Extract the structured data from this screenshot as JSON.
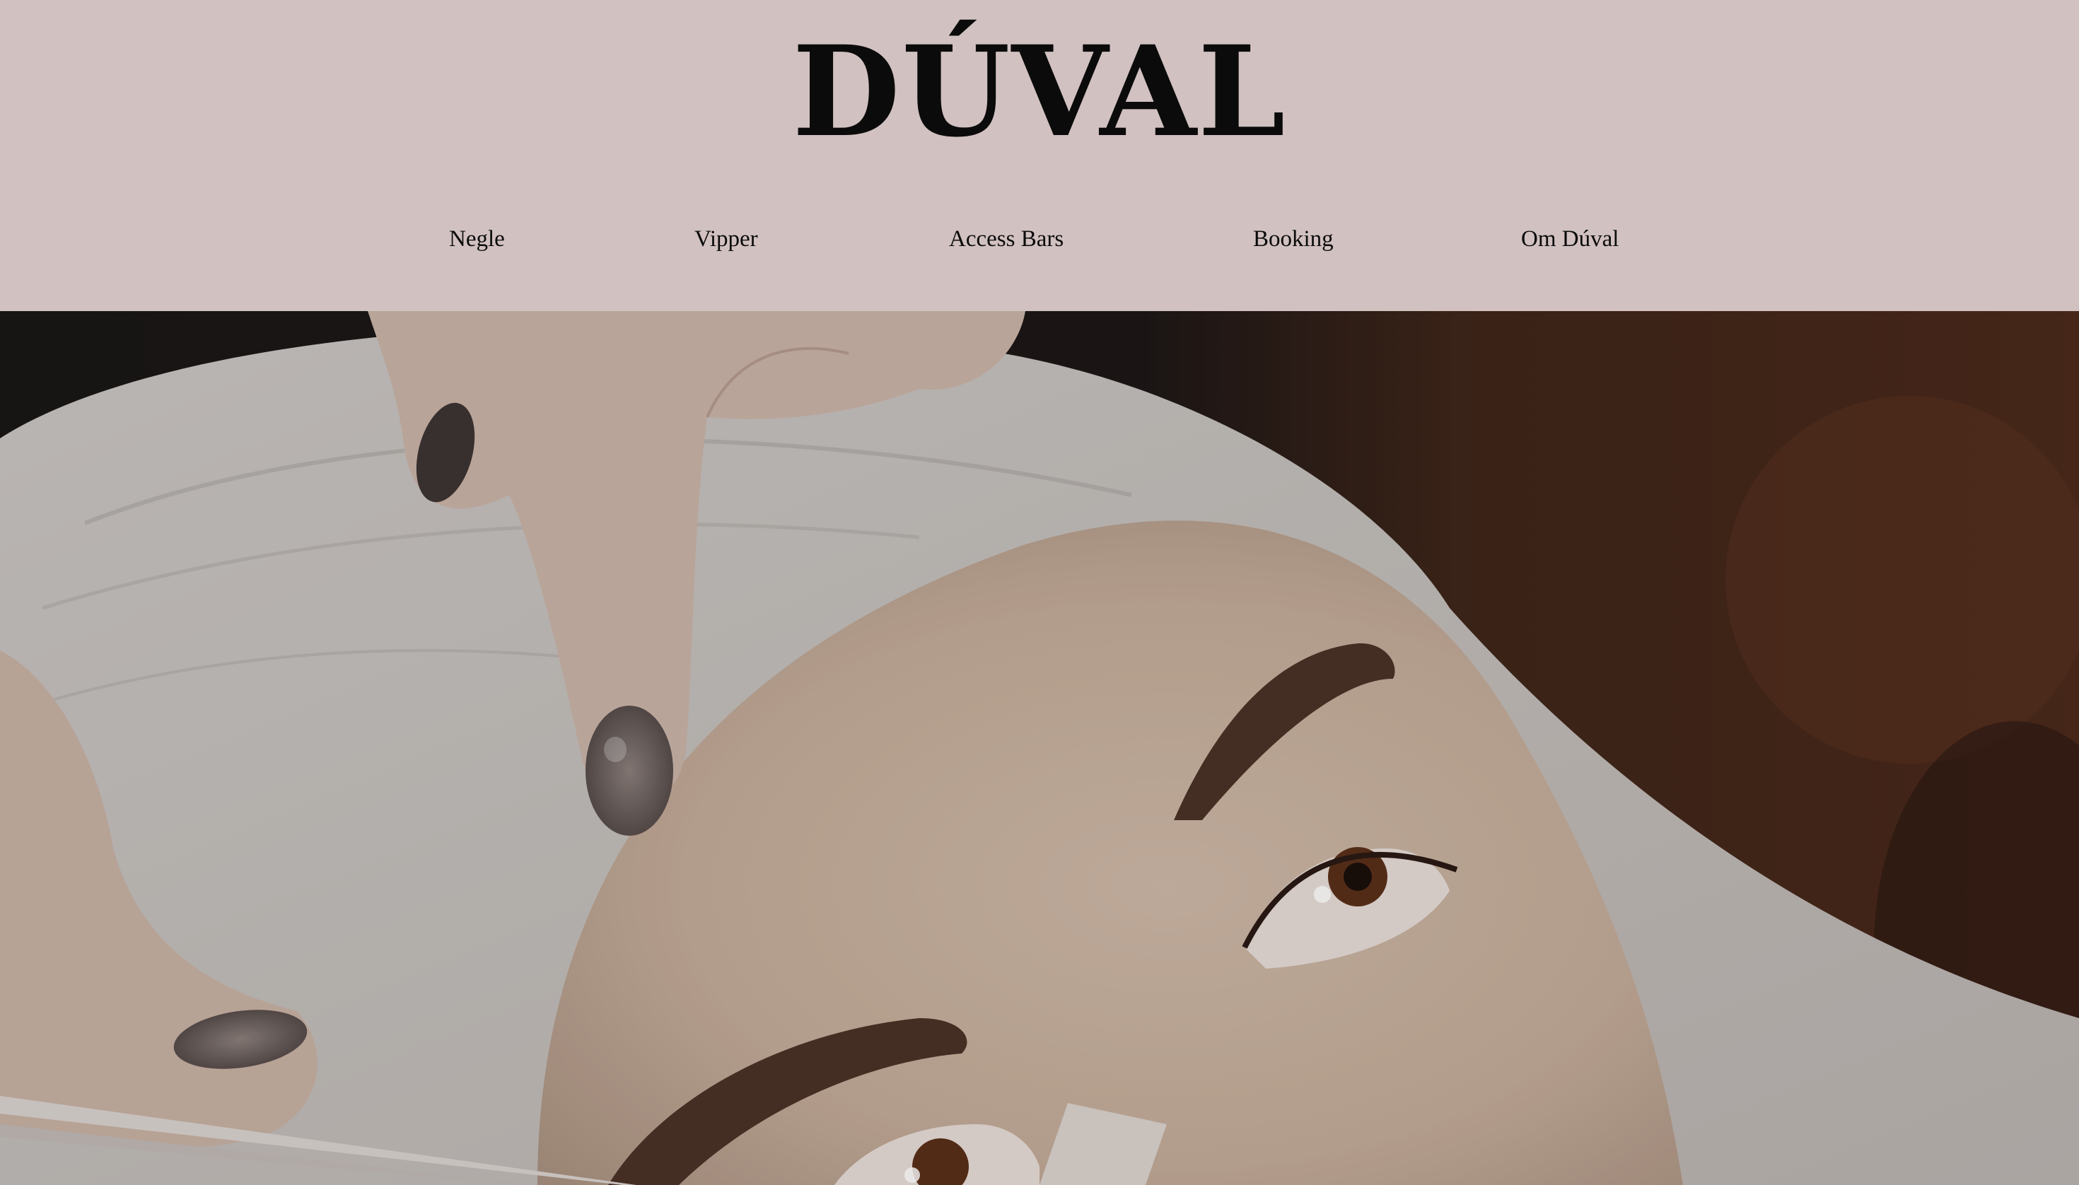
{
  "header": {
    "logo": "DÚVAL"
  },
  "nav": {
    "items": [
      {
        "label": "Negle"
      },
      {
        "label": "Vipper"
      },
      {
        "label": "Access Bars"
      },
      {
        "label": "Booking"
      },
      {
        "label": "Om Dúval"
      }
    ]
  },
  "colors": {
    "header_bg": "#d1c1c0",
    "text": "#0b0b0b",
    "hero_dark": "#1a1615",
    "hero_warm": "#4a2a1e"
  },
  "hero": {
    "image_description_icon": "eyelash-treatment-photo"
  }
}
